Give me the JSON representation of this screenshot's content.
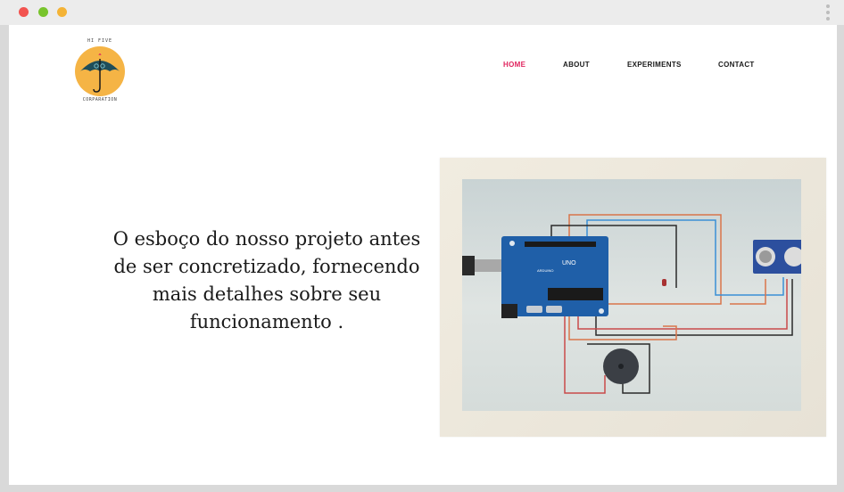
{
  "logo": {
    "top_text": "HI FIVE",
    "bottom_text": "CORPARATION"
  },
  "nav": {
    "items": [
      {
        "label": "HOME",
        "active": true
      },
      {
        "label": "ABOUT",
        "active": false
      },
      {
        "label": "EXPERIMENTS",
        "active": false
      },
      {
        "label": "CONTACT",
        "active": false
      }
    ]
  },
  "hero": {
    "headline": "O esboço do nosso projeto antes de ser concretizado, fornecendo mais detalhes sobre seu funcionamento ."
  },
  "colors": {
    "accent": "#e0245e",
    "logo_circle": "#f5b445",
    "umbrella": "#1f4e5a",
    "arduino_blue": "#1f5fa8"
  },
  "circuit": {
    "board_label": "UNO",
    "board_brand": "ARDUINO"
  }
}
